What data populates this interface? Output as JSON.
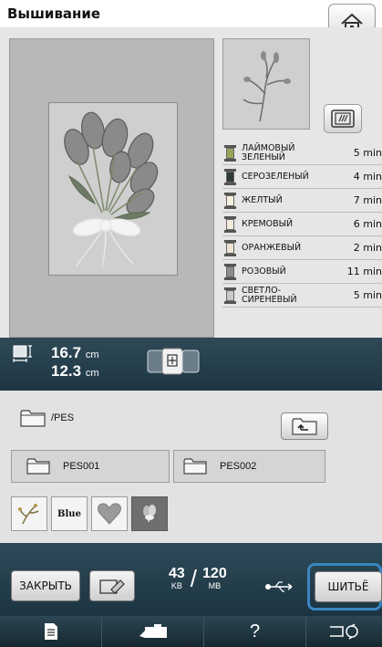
{
  "title": "Вышивание",
  "icons": {
    "home": "home-icon",
    "frame_toggle": "frame-display-icon",
    "size": "size-icon",
    "memory": "embroidery-memory-icon",
    "folder": "folder-icon",
    "up": "folder-up-icon",
    "delete": "delete-icon",
    "usb": "usb-icon",
    "settings": "settings-icon",
    "help": "help-icon",
    "sewing_machine": "sewing-machine-icon",
    "camera": "camera-icon"
  },
  "colors": {
    "panel_bg": "#e6e6e6",
    "bar_bg": "#234050",
    "highlight": "#3a86c0"
  },
  "threads": [
    {
      "name": "ЛАЙМОВЫЙ ЗЕЛЕНЫЙ",
      "time": "5 min",
      "color": "#9aa35a"
    },
    {
      "name": "СЕРОЗЕЛЕНЫЙ",
      "time": "4 min",
      "color": "#2f3a33"
    },
    {
      "name": "ЖЕЛТЫЙ",
      "time": "7 min",
      "color": "#f6f2de"
    },
    {
      "name": "КРЕМОВЫЙ",
      "time": "6 min",
      "color": "#f2ecdf"
    },
    {
      "name": "ОРАНЖЕВЫЙ",
      "time": "2 min",
      "color": "#ede3d0"
    },
    {
      "name": "РОЗОВЫЙ",
      "time": "11 min",
      "color": "#8c8c8c"
    },
    {
      "name": "СВЕТЛО-СИРЕНЕВЫЙ",
      "time": "5 min",
      "color": "#c8c8c8"
    }
  ],
  "dimensions": {
    "height_value": "16.7",
    "height_unit": "cm",
    "width_value": "12.3",
    "width_unit": "cm"
  },
  "file_browser": {
    "path": "/PES",
    "folders": [
      "PES001",
      "PES002"
    ],
    "thumb_text_label": "Blue"
  },
  "action": {
    "close_label": "ЗАКРЫТЬ",
    "sew_label": "ШИТЬЁ",
    "used_value": "43",
    "used_unit": "KB",
    "total_value": "120",
    "total_unit": "MB"
  },
  "bottom_bar": {
    "help": "?"
  }
}
